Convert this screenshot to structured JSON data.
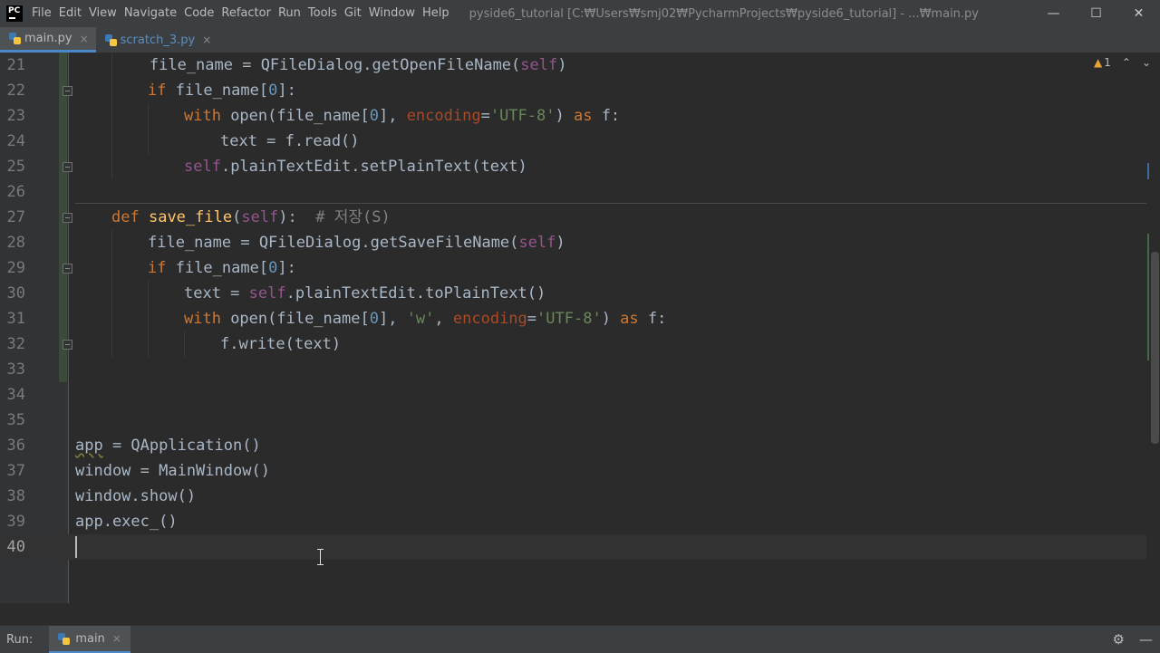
{
  "app": {
    "window_title": "pyside6_tutorial [C:₩Users₩smj02₩PycharmProjects₩pyside6_tutorial] - ...₩main.py",
    "logo_text": "PC"
  },
  "menu": [
    {
      "label": "File"
    },
    {
      "label": "Edit"
    },
    {
      "label": "View"
    },
    {
      "label": "Navigate"
    },
    {
      "label": "Code"
    },
    {
      "label": "Refactor"
    },
    {
      "label": "Run"
    },
    {
      "label": "Tools"
    },
    {
      "label": "Git"
    },
    {
      "label": "Window"
    },
    {
      "label": "Help"
    }
  ],
  "window_controls": {
    "minimize": "—",
    "maximize": "☐",
    "close": "✕"
  },
  "tabs": [
    {
      "name": "main.py",
      "active": true,
      "close": "×"
    },
    {
      "name": "scratch_3.py",
      "active": false,
      "close": "×"
    }
  ],
  "inspection": {
    "warn_icon": "▲",
    "count": "1",
    "up": "⌃",
    "down": "⌄"
  },
  "line_numbers": [
    "21",
    "22",
    "23",
    "24",
    "25",
    "26",
    "27",
    "28",
    "29",
    "30",
    "31",
    "32",
    "33",
    "34",
    "35",
    "36",
    "37",
    "38",
    "39",
    "40"
  ],
  "code": {
    "l21": {
      "a": "        file_name = QFileDialog.getOpenFileName(",
      "b": "self",
      "c": ")"
    },
    "l22": {
      "kw": "if",
      "a": " file_name[",
      "n": "0",
      "b": "]:"
    },
    "l23": {
      "kw": "with",
      "a": " open(file_name[",
      "n": "0",
      "b": "], ",
      "p": "encoding",
      "eq": "=",
      "s": "'UTF-8'",
      "c": ") ",
      "kw2": "as",
      "d": " f:"
    },
    "l24": {
      "a": "text = f.read()"
    },
    "l25": {
      "self": "self",
      "a": ".plainTextEdit.setPlainText(text)"
    },
    "l27": {
      "kw": "def",
      "fn": "save_file",
      "a": "(",
      "self": "self",
      "b": "):  ",
      "cmt": "# 저장(S)"
    },
    "l28": {
      "a": "file_name = QFileDialog.getSaveFileName(",
      "b": "self",
      "c": ")"
    },
    "l29": {
      "kw": "if",
      "a": " file_name[",
      "n": "0",
      "b": "]:"
    },
    "l30": {
      "a": "text = ",
      "self": "self",
      "b": ".plainTextEdit.toPlainText()"
    },
    "l31": {
      "kw": "with",
      "a": " open(file_name[",
      "n": "0",
      "b": "], ",
      "s1": "'w'",
      "c": ", ",
      "p": "encoding",
      "eq": "=",
      "s": "'UTF-8'",
      "d": ") ",
      "kw2": "as",
      "e": " f:"
    },
    "l32": {
      "a": "f.write(text)"
    },
    "l36": {
      "a": "app",
      "b": " = QApplication()"
    },
    "l37": {
      "a": "window = MainWindow()"
    },
    "l38": {
      "a": "window.show()"
    },
    "l39": {
      "a": "app.exec_()"
    }
  },
  "run_bar": {
    "label": "Run:",
    "tab": "main",
    "close": "×",
    "gear": "⚙",
    "hide": "—"
  },
  "colors": {
    "background": "#2b2b2b",
    "keyword": "#cc7832",
    "self": "#94558d",
    "string": "#6a8759",
    "number": "#6897bb",
    "function": "#ffc66d",
    "comment": "#808080"
  }
}
